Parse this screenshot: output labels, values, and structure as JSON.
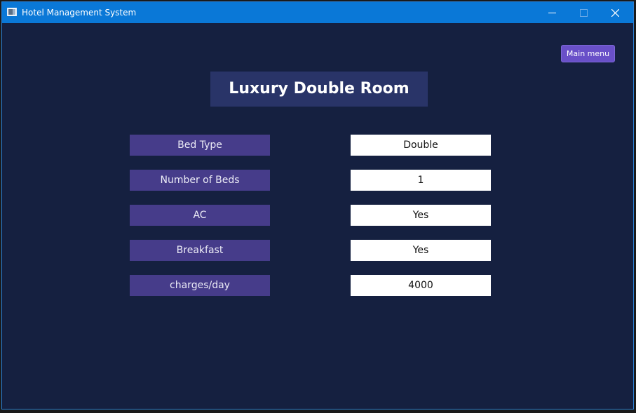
{
  "window": {
    "title": "Hotel Management System",
    "app_icon": "window-app-icon",
    "controls": {
      "minimize_icon": "minimize-icon",
      "maximize_icon": "maximize-icon",
      "close_icon": "close-icon"
    }
  },
  "header": {
    "main_menu_label": "Main menu"
  },
  "room": {
    "title": "Luxury Double Room",
    "details": [
      {
        "label": "Bed Type",
        "value": "Double"
      },
      {
        "label": "Number of Beds",
        "value": "1"
      },
      {
        "label": "AC",
        "value": "Yes"
      },
      {
        "label": "Breakfast",
        "value": "Yes"
      },
      {
        "label": "charges/day",
        "value": "4000"
      }
    ]
  },
  "colors": {
    "titlebar": "#0a78d7",
    "background": "#152040",
    "title_panel": "#293468",
    "label_panel": "#463c8a",
    "value_panel": "#ffffff",
    "button": "#6950c8"
  }
}
